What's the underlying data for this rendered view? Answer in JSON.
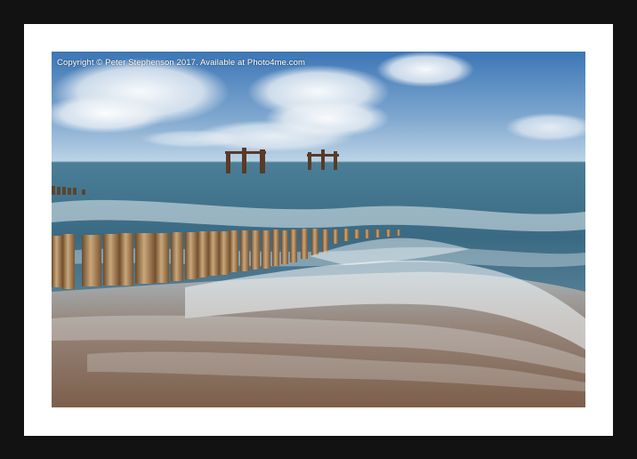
{
  "watermark": {
    "text": "Copyright  © Peter Stephenson  2017. Available at Photo4me.com"
  },
  "colors": {
    "frame": "#121212",
    "mount": "#ffffff",
    "sky_top": "#3f78b8",
    "sky_horizon": "#b9d2e6",
    "sea": "#3e6e86",
    "sand": "#8a6e58"
  }
}
